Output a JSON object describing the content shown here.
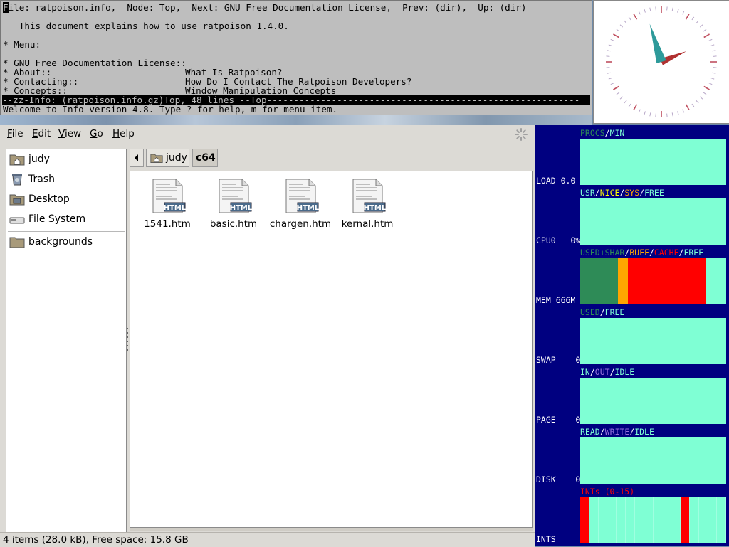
{
  "info": {
    "header_cursor": "F",
    "header_rest": "ile: ratpoison.info,  Node: Top,  Next: GNU Free Documentation License,  Prev: (dir),  Up: (dir)",
    "intro": "   This document explains how to use ratpoison 1.4.0.",
    "menu_title": "* Menu:",
    "menu_items": [
      {
        "entry": "* GNU Free Documentation License::",
        "desc": ""
      },
      {
        "entry": "* About::",
        "desc": "What Is Ratpoison?"
      },
      {
        "entry": "* Contacting::",
        "desc": "How Do I Contact The Ratpoison Developers?"
      },
      {
        "entry": "* Concepts::",
        "desc": "Window Manipulation Concepts"
      }
    ],
    "modeline": "--zz-Info: (ratpoison.info.gz)Top, 48 lines --Top----------------------------------------------------------",
    "echo": "Welcome to Info version 4.8. Type ? for help, m for menu item."
  },
  "clock": {
    "hour_hand_angle_deg": 67,
    "minute_hand_angle_deg": 343,
    "colors": {
      "hour": "#b03030",
      "minute": "#2e9a9a",
      "ticks": "#b8a8c8"
    }
  },
  "file_manager": {
    "menus": [
      {
        "first": "F",
        "rest": "ile"
      },
      {
        "first": "E",
        "rest": "dit"
      },
      {
        "first": "V",
        "rest": "iew"
      },
      {
        "first": "G",
        "rest": "o"
      },
      {
        "first": "H",
        "rest": "elp"
      }
    ],
    "sidebar": [
      {
        "label": "judy",
        "icon": "home-folder-icon"
      },
      {
        "label": "Trash",
        "icon": "trash-icon"
      },
      {
        "label": "Desktop",
        "icon": "desktop-icon"
      },
      {
        "label": "File System",
        "icon": "drive-icon"
      },
      {
        "label": "backgrounds",
        "icon": "folder-icon"
      }
    ],
    "path": [
      "judy",
      "c64"
    ],
    "files": [
      {
        "name": "1541.htm",
        "badge": "HTML"
      },
      {
        "name": "basic.htm",
        "badge": "HTML"
      },
      {
        "name": "chargen.htm",
        "badge": "HTML"
      },
      {
        "name": "kernal.htm",
        "badge": "HTML"
      }
    ],
    "status": "4 items (28.0 kB), Free space: 15.8 GB"
  },
  "monitor": {
    "colors": {
      "bg": "#000080",
      "graph": "#7fffd4",
      "used": "#2e8b57",
      "buff": "#ffa500",
      "cache": "#ff0000"
    },
    "panels": [
      {
        "header": [
          {
            "t": "PROCS",
            "c": "#2e8b57"
          },
          {
            "t": "/",
            "c": "#ffffff"
          },
          {
            "t": "MIN",
            "c": "#7fffd4"
          }
        ],
        "value": "LOAD 0.0"
      },
      {
        "header": [
          {
            "t": "USR",
            "c": "#7fffd4"
          },
          {
            "t": "/",
            "c": "#ffffff"
          },
          {
            "t": "NICE",
            "c": "#ffff00"
          },
          {
            "t": "/",
            "c": "#ffffff"
          },
          {
            "t": "SYS",
            "c": "#ffa500"
          },
          {
            "t": "/",
            "c": "#ffffff"
          },
          {
            "t": "FREE",
            "c": "#7fffd4"
          }
        ],
        "value": "CPU0   0%"
      },
      {
        "header": [
          {
            "t": "USED+SHAR",
            "c": "#2e8b57"
          },
          {
            "t": "/",
            "c": "#ffffff"
          },
          {
            "t": "BUFF",
            "c": "#ffa500"
          },
          {
            "t": "/",
            "c": "#ffffff"
          },
          {
            "t": "CACHE",
            "c": "#ff0000"
          },
          {
            "t": "/",
            "c": "#ffffff"
          },
          {
            "t": "FREE",
            "c": "#7fffd4"
          }
        ],
        "value": "MEM 666M"
      },
      {
        "header": [
          {
            "t": "USED",
            "c": "#2e8b57"
          },
          {
            "t": "/",
            "c": "#ffffff"
          },
          {
            "t": "FREE",
            "c": "#7fffd4"
          }
        ],
        "value": "SWAP    0"
      },
      {
        "header": [
          {
            "t": "IN",
            "c": "#7fffd4"
          },
          {
            "t": "/",
            "c": "#ffffff"
          },
          {
            "t": "OUT",
            "c": "#9370db"
          },
          {
            "t": "/",
            "c": "#ffffff"
          },
          {
            "t": "IDLE",
            "c": "#7fffd4"
          }
        ],
        "value": "PAGE    0"
      },
      {
        "header": [
          {
            "t": "READ",
            "c": "#7fffd4"
          },
          {
            "t": "/",
            "c": "#ffffff"
          },
          {
            "t": "WRITE",
            "c": "#9370db"
          },
          {
            "t": "/",
            "c": "#ffffff"
          },
          {
            "t": "IDLE",
            "c": "#7fffd4"
          }
        ],
        "value": "DISK    0"
      },
      {
        "header": [
          {
            "t": "INTs (0-15)",
            "c": "#ff0000"
          }
        ],
        "value": "INTS"
      }
    ],
    "mem_fractions": {
      "used": 0.26,
      "buff": 0.07,
      "cache": 0.53,
      "free": 0.14
    },
    "ints_active": [
      0,
      11
    ]
  }
}
